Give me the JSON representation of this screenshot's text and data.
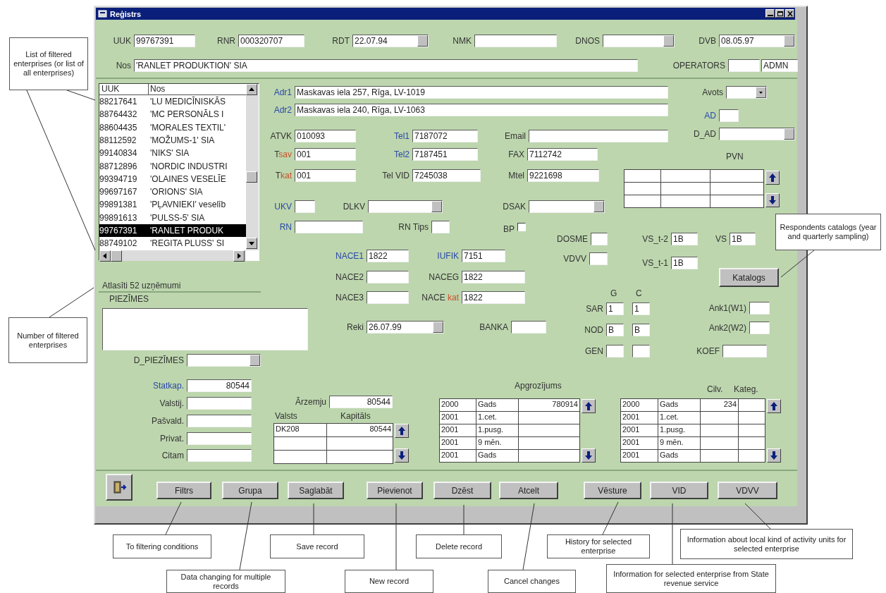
{
  "window": {
    "title": "Reģistrs"
  },
  "fields": [
    {
      "label": "UUK",
      "value": "99767391",
      "kind": "text"
    },
    {
      "label": "RNR",
      "value": "000320707",
      "kind": "text"
    },
    {
      "label": "RDT",
      "value": "22.07.94",
      "kind": "combo"
    },
    {
      "label": "NMK",
      "kind": "text"
    },
    {
      "label": "DNOS",
      "kind": "combo"
    },
    {
      "label": "DVB",
      "value": "08.05.97",
      "kind": "combo"
    },
    {
      "label": "Nos",
      "value": "'RANLET PRODUKTION' SIA",
      "kind": "text"
    },
    {
      "label": "OPERATORS",
      "kind": "text"
    },
    {
      "value": "ADMN",
      "kind": "text"
    },
    {
      "label": "Adr1",
      "color": "#2a48a8",
      "value": "Maskavas iela 257, Rīga, LV-1019",
      "kind": "text"
    },
    {
      "label": "Adr2",
      "color": "#2a48a8",
      "value": "Maskavas iela 240, Rīga, LV-1063",
      "kind": "text"
    },
    {
      "label": "Avots",
      "kind": "dropdown"
    },
    {
      "label": "AD",
      "color": "#2a48a8",
      "kind": "text"
    },
    {
      "label": "ATVK",
      "value": "010093",
      "kind": "text"
    },
    {
      "label": "Tel1",
      "color": "#2a48a8",
      "value": "7187072",
      "kind": "text"
    },
    {
      "label": "Email",
      "kind": "text"
    },
    {
      "label": "D_AD",
      "kind": "combo"
    },
    {
      "label": "T",
      "label_accent": "sav",
      "value": "001",
      "kind": "text"
    },
    {
      "label": "Tel2",
      "color": "#2a48a8",
      "value": "7187451",
      "kind": "text"
    },
    {
      "label": "FAX",
      "value": "7112742",
      "kind": "text"
    },
    {
      "label": "T",
      "label_accent": "kat",
      "value": "001",
      "kind": "text"
    },
    {
      "label": "Tel VID",
      "value": "7245038",
      "kind": "text"
    },
    {
      "label": "Mtel",
      "value": "9221698",
      "kind": "text"
    },
    {
      "label": "UKV",
      "color": "#2a48a8",
      "kind": "text"
    },
    {
      "label": "DLKV",
      "kind": "combo"
    },
    {
      "label": "DSAK",
      "kind": "combo"
    },
    {
      "label": "RN",
      "color": "#2a48a8",
      "kind": "text"
    },
    {
      "label": "RN Tips",
      "kind": "text"
    },
    {
      "label": "BP",
      "kind": "check",
      "checked": false
    },
    {
      "label": "DOSME",
      "kind": "text"
    },
    {
      "label": "VS_t-2",
      "value": "1B",
      "kind": "text"
    },
    {
      "label": "VS",
      "value": "1B",
      "kind": "text"
    },
    {
      "label": "NACE1",
      "color": "#2a48a8",
      "value": "1822",
      "kind": "text"
    },
    {
      "label": "IUFIK",
      "color": "#2a48a8",
      "value": "7151",
      "kind": "text"
    },
    {
      "label": "VDVV",
      "kind": "text"
    },
    {
      "label": "VS_t-1",
      "value": "1B",
      "kind": "text"
    },
    {
      "label": "NACE2",
      "kind": "text"
    },
    {
      "label": "NACEG",
      "value": "1822",
      "kind": "text"
    },
    {
      "label": "Katalogs",
      "kind": "button"
    },
    {
      "label": "NACE3",
      "kind": "text"
    },
    {
      "label": "NACE ",
      "label_accent": "kat",
      "value": "1822",
      "kind": "text"
    },
    {
      "label": "G",
      "kind": "heading"
    },
    {
      "label": "C",
      "kind": "heading"
    },
    {
      "label": "SAR",
      "value": "1",
      "kind": "text"
    },
    {
      "value": "1",
      "kind": "text"
    },
    {
      "label": "Ank1(W1)",
      "kind": "text"
    },
    {
      "label": "Reki",
      "value": "26.07.99",
      "kind": "combo"
    },
    {
      "label": "BANKA",
      "kind": "text"
    },
    {
      "label": "NOD",
      "value": "B",
      "kind": "text"
    },
    {
      "value": "B",
      "kind": "text"
    },
    {
      "label": "Ank2(W2)",
      "kind": "text"
    },
    {
      "label": "GEN",
      "kind": "text"
    },
    {
      "kind": "text"
    },
    {
      "label": "KOEF",
      "kind": "text"
    },
    {
      "label": "D_PIEZĪMES",
      "kind": "combo"
    },
    {
      "label": "Statkap.",
      "color": "#2a48a8",
      "value": "80544",
      "kind": "number"
    },
    {
      "label": "Valstij.",
      "kind": "number"
    },
    {
      "label": "Pašvald.",
      "kind": "number"
    },
    {
      "label": "Privat.",
      "kind": "number"
    },
    {
      "label": "Citam",
      "kind": "number"
    },
    {
      "label": "Ārzemju",
      "value": "80544",
      "kind": "number"
    }
  ],
  "list": {
    "columns": [
      "UUK",
      "Nos"
    ],
    "rows": [
      {
        "uuk": "88217641",
        "name": "'LU MEDICĪNISKĀS",
        "selected": false
      },
      {
        "uuk": "88764432",
        "name": "'MC PERSONĀLS I",
        "selected": false
      },
      {
        "uuk": "88604435",
        "name": "'MORALES TEXTIL'",
        "selected": false
      },
      {
        "uuk": "88112592",
        "name": "'MOŽUMS-1' SIA",
        "selected": false
      },
      {
        "uuk": "99140834",
        "name": "'NIKS' SIA",
        "selected": false
      },
      {
        "uuk": "88712896",
        "name": "'NORDIC INDUSTRI",
        "selected": false
      },
      {
        "uuk": "99394719",
        "name": "'OLAINES VESELĪE",
        "selected": false
      },
      {
        "uuk": "99697167",
        "name": "'ORIONS' SIA",
        "selected": false
      },
      {
        "uuk": "99891381",
        "name": "'PĻAVNIEKI' veselīb",
        "selected": false
      },
      {
        "uuk": "99891613",
        "name": "'PULSS-5' SIA",
        "selected": false
      },
      {
        "uuk": "99767391",
        "name": "'RANLET PRODUK",
        "selected": true
      },
      {
        "uuk": "88749102",
        "name": "'REGITA PLUSS' SI",
        "selected": false
      }
    ]
  },
  "status": "Atlasīti 52 uzņēmumi",
  "notes": {
    "label": "PIEZĪMES"
  },
  "pvn": {
    "label": "PVN"
  },
  "capital": {
    "columns": [
      "Valsts",
      "Kapitāls"
    ],
    "rows": [
      {
        "cells": [
          "DK208",
          "80544"
        ]
      }
    ]
  },
  "turnover": {
    "title": "Apgrozījums",
    "rows": [
      {
        "cells": [
          "2000",
          "Gads",
          "780914"
        ]
      },
      {
        "cells": [
          "2001",
          "1.cet."
        ]
      },
      {
        "cells": [
          "2001",
          "1.pusg."
        ]
      },
      {
        "cells": [
          "2001",
          "9 mēn."
        ]
      },
      {
        "cells": [
          "2001",
          "Gads"
        ]
      }
    ]
  },
  "employees": {
    "columns": [
      "Cilv.",
      "Kateg."
    ],
    "rows": [
      {
        "cells": [
          "2000",
          "Gads",
          "234"
        ]
      },
      {
        "cells": [
          "2001",
          "1.cet."
        ]
      },
      {
        "cells": [
          "2001",
          "1.pusg."
        ]
      },
      {
        "cells": [
          "2001",
          "9 mēn."
        ]
      },
      {
        "cells": [
          "2001",
          "Gads"
        ]
      }
    ]
  },
  "buttons": [
    {
      "kind": "exit"
    },
    {
      "kind": "text",
      "label": "Filtrs"
    },
    {
      "kind": "text",
      "label": "Grupa"
    },
    {
      "kind": "text",
      "label": "Saglabāt"
    },
    {
      "kind": "text",
      "label": "Pievienot"
    },
    {
      "kind": "text",
      "label": "Dzēst"
    },
    {
      "kind": "text",
      "label": "Atcelt"
    },
    {
      "kind": "text",
      "label": "Vēsture"
    },
    {
      "kind": "text",
      "label": "VID"
    },
    {
      "kind": "text",
      "label": "VDVV"
    }
  ],
  "annotations": [
    {
      "text": "List of filtered enterprises (or list of all enterprises)"
    },
    {
      "text": "Number of filtered enterprises"
    },
    {
      "text": "Respondents catalogs (year and quarterly sampling)"
    },
    {
      "text": "To filtering conditions"
    },
    {
      "text": "Data changing for multiple records"
    },
    {
      "text": "Save record"
    },
    {
      "text": "New record"
    },
    {
      "text": "Delete record"
    },
    {
      "text": "Cancel changes"
    },
    {
      "text": "History for selected enterprise"
    },
    {
      "text": "Information for selected enterprise from State revenue service"
    },
    {
      "text": "Information about local kind of activity units for selected enterprise"
    }
  ]
}
